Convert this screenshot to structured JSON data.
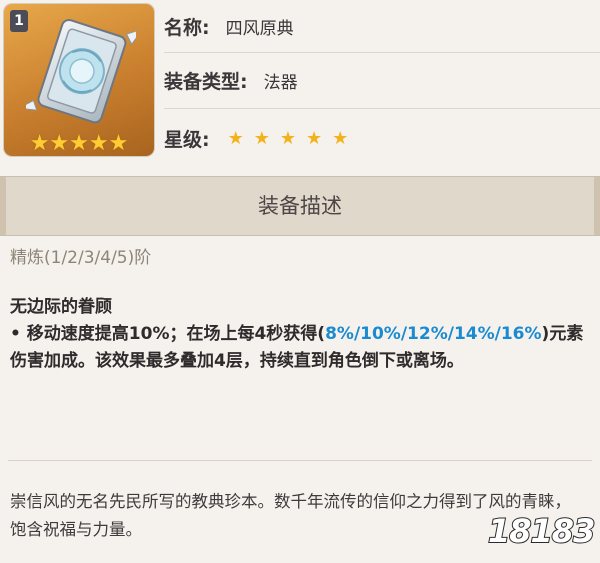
{
  "weapon": {
    "refinement_badge": "1",
    "card_stars": "★★★★★",
    "name_label": "名称:",
    "name_value": "四风原典",
    "type_label": "装备类型:",
    "type_value": "法器",
    "rarity_label": "星级:",
    "rarity": 5,
    "rarity_star": "★"
  },
  "description": {
    "section_title": "装备描述",
    "refinement_levels": "精炼(1/2/3/4/5)阶",
    "effect_name": "无边际的眷顾",
    "effect_desc_prefix": "• 移动速度提高10%；在场上每4秒获得(",
    "effect_desc_values": "8%/10%/12%/14%/16%",
    "effect_desc_suffix": ")元素伤害加成。该效果最多叠加4层，持续直到角色倒下或离场。",
    "lore": "崇信风的无名先民所写的教典珍本。数千年流传的信仰之力得到了风的青睐，饱含祝福与力量。"
  },
  "watermark": "18183",
  "colors": {
    "background": "#f5f2ed",
    "header_band": "#e0d8ca",
    "highlight": "#1a8ad1",
    "star": "#f3b21b",
    "card_gradient_top": "#e8a84a"
  }
}
